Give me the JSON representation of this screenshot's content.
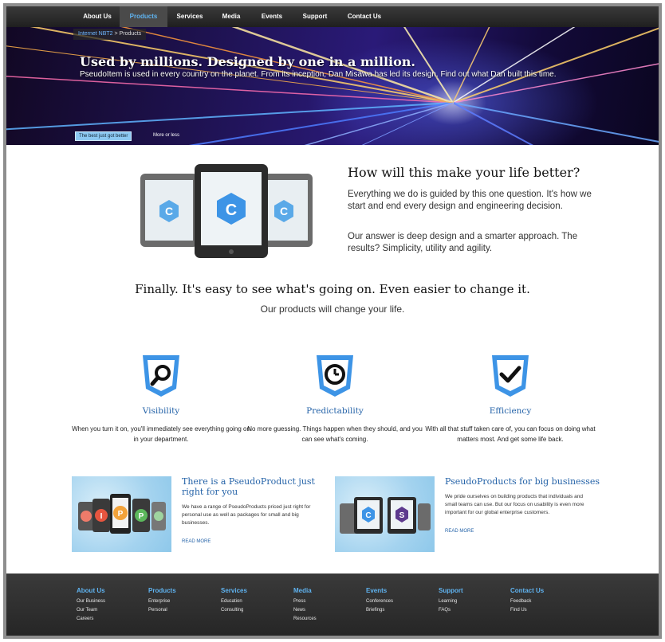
{
  "nav": {
    "items": [
      {
        "label": "About Us"
      },
      {
        "label": "Products"
      },
      {
        "label": "Services"
      },
      {
        "label": "Media"
      },
      {
        "label": "Events"
      },
      {
        "label": "Support"
      },
      {
        "label": "Contact Us"
      }
    ],
    "active": "Products",
    "active_color": "#5fb3f0"
  },
  "breadcrumb": {
    "link": "Internet NBT2",
    "separator": " > ",
    "current": "Products"
  },
  "hero": {
    "title": "Used by millions. Designed by one in a million.",
    "description": "PseudoItem is used in every country on the planet. From its inception, Dan Misawa has led its design. Find out what Dan built this time.",
    "tabs": [
      "The best just got better",
      "More or less"
    ]
  },
  "intro": {
    "title": "How will this make your life better?",
    "para1": "Everything we do is guided by this one question. It's how we start and end every design and engineering decision.",
    "para2": "Our answer is deep design and a smarter approach. The results? Simplicity, utility and agility."
  },
  "tagline": "Finally. It's easy to see what's going on. Even easier to change it.",
  "subtagline": "Our products will change your life.",
  "features": [
    {
      "title": "Visibility",
      "icon": "magnifier-icon",
      "desc": "When you turn it on, you'll immediately see everything going on in your department."
    },
    {
      "title": "Predictability",
      "icon": "clock-icon",
      "desc": "No more guessing. Things happen when they should, and you can see what's coming."
    },
    {
      "title": "Efficiency",
      "icon": "checkmark-icon",
      "desc": "With all that stuff taken care of, you can focus on doing what matters most. And get some life back."
    }
  ],
  "promos": [
    {
      "title": "There is a PseudoProduct just right for you",
      "text": "We have a range of PseudoProducts priced just right for personal use as well as packages for small and big businesses.",
      "link": "READ MORE"
    },
    {
      "title": "PseudoProducts for big businesses",
      "text": "We pride ourselves on building products that individuals and small teams can use. But our focus on usability is even more important for our global enterprise customers.",
      "link": "READ MORE"
    }
  ],
  "footer": {
    "columns": [
      {
        "head": "About Us",
        "links": [
          "Our Business",
          "Our Team",
          "Careers"
        ]
      },
      {
        "head": "Products",
        "links": [
          "Enterprise",
          "Personal"
        ]
      },
      {
        "head": "Services",
        "links": [
          "Education",
          "Consulting"
        ]
      },
      {
        "head": "Media",
        "links": [
          "Press",
          "News",
          "Resources"
        ]
      },
      {
        "head": "Events",
        "links": [
          "Conferences",
          "Briefings"
        ]
      },
      {
        "head": "Support",
        "links": [
          "Learning",
          "FAQs"
        ]
      },
      {
        "head": "Contact Us",
        "links": [
          "Feedback",
          "Find Us"
        ]
      }
    ]
  },
  "colors": {
    "accent_blue": "#3d94e6",
    "link_blue": "#2563a8",
    "footer_bg": "#2e2e2e"
  }
}
